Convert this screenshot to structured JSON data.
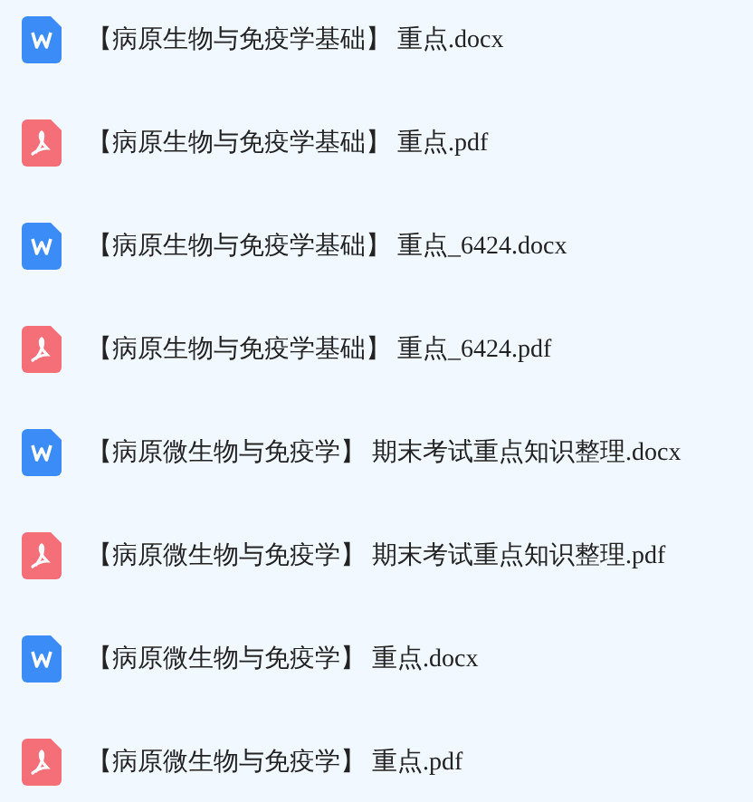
{
  "files": [
    {
      "kind": "word",
      "name": "【病原生物与免疫学基础】 重点.docx"
    },
    {
      "kind": "pdf",
      "name": "【病原生物与免疫学基础】 重点.pdf"
    },
    {
      "kind": "word",
      "name": "【病原生物与免疫学基础】 重点_6424.docx"
    },
    {
      "kind": "pdf",
      "name": "【病原生物与免疫学基础】 重点_6424.pdf"
    },
    {
      "kind": "word",
      "name": "【病原微生物与免疫学】 期末考试重点知识整理.docx"
    },
    {
      "kind": "pdf",
      "name": "【病原微生物与免疫学】 期末考试重点知识整理.pdf"
    },
    {
      "kind": "word",
      "name": "【病原微生物与免疫学】 重点.docx"
    },
    {
      "kind": "pdf",
      "name": "【病原微生物与免疫学】 重点.pdf"
    }
  ]
}
